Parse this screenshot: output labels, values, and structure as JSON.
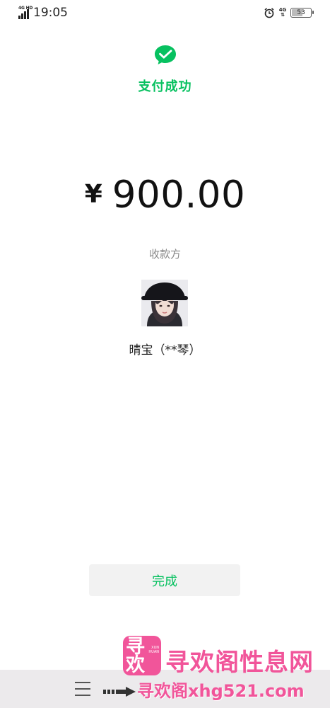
{
  "status_bar": {
    "network_type": "4G HD",
    "time": "19:05",
    "network_small": "4G",
    "battery_level": "53",
    "battery_fraction": 0.53
  },
  "payment": {
    "icon": "wechat-pay-check-icon",
    "status_text": "支付成功",
    "currency_symbol": "¥",
    "amount": "900.00",
    "payee_label": "收款方",
    "payee_name": "晴宝（**琴）",
    "done_label": "完成"
  },
  "nav_bar": {
    "menu_icon": "menu-icon"
  },
  "watermark": {
    "logo_glyph": "寻欢",
    "logo_mark": "XUN HUAN",
    "site_name": "寻欢阁性息网",
    "url_text": "寻欢阁xhg521.com"
  },
  "colors": {
    "accent": "#07c160",
    "watermark": "#f1559a",
    "button_bg": "#f2f2f2",
    "nav_bg": "#eceaec"
  }
}
